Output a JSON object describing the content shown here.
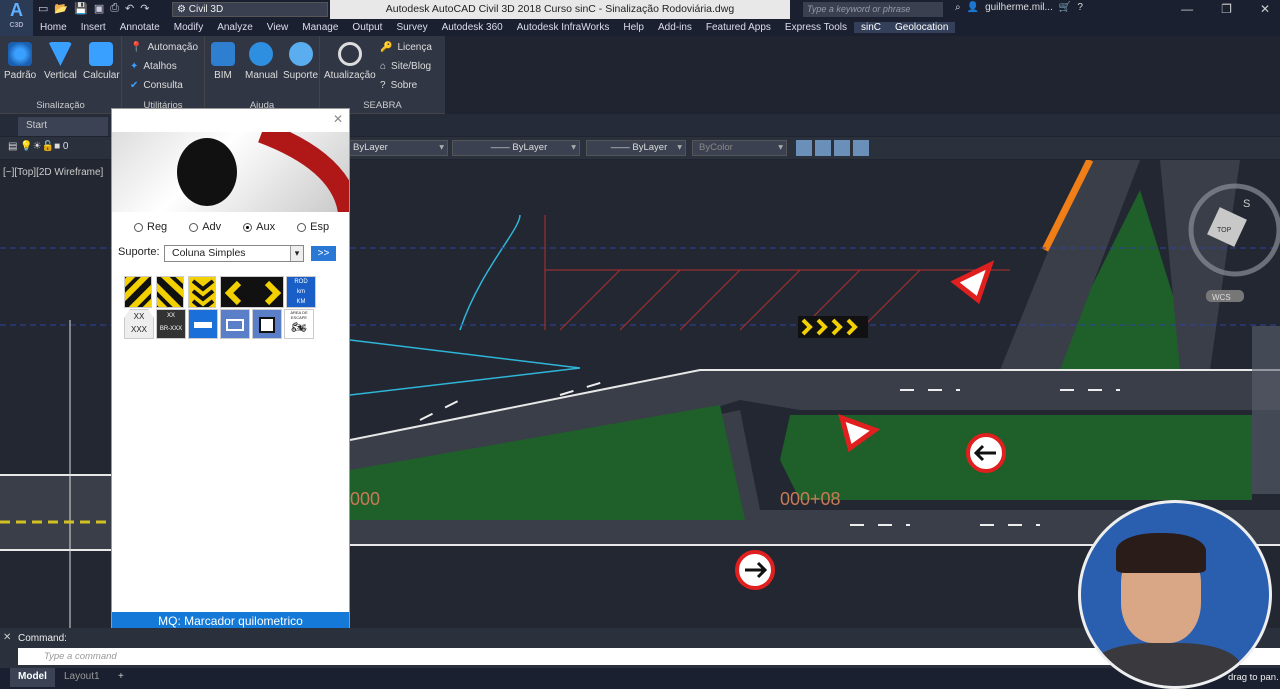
{
  "app": {
    "logo_top": "A",
    "logo_bottom": "C3D",
    "workspace": "Civil 3D",
    "title": "Autodesk AutoCAD Civil 3D 2018   Curso sinC - Sinalização Rodoviária.dwg",
    "search_placeholder": "Type a keyword or phrase",
    "user": "guilherme.mil..."
  },
  "menu": [
    "Home",
    "Insert",
    "Annotate",
    "Modify",
    "Analyze",
    "View",
    "Manage",
    "Output",
    "Survey",
    "Autodesk 360",
    "Autodesk InfraWorks",
    "Help",
    "Add-ins",
    "Featured Apps",
    "Express Tools",
    "sinC",
    "Geolocation"
  ],
  "ribbon": {
    "sinalizacao": {
      "label": "Sinalização",
      "buttons": [
        "Padrão",
        "Vertical",
        "Calcular"
      ]
    },
    "utilitarios": {
      "label": "Utilitários",
      "items": [
        "Automação",
        "Atalhos",
        "Consulta"
      ]
    },
    "ajuda": {
      "label": "Ajuda",
      "buttons": [
        "BIM",
        "Manual",
        "Suporte"
      ]
    },
    "seabra": {
      "label": "SEABRA",
      "button": "Atualização",
      "items": [
        "Licença",
        "Site/Blog",
        "Sobre"
      ]
    }
  },
  "tabs": {
    "start": "Start"
  },
  "layers": {
    "layer0": "0",
    "color": "ByLayer",
    "linetype": "ByLayer",
    "lineweight": "ByLayer",
    "plotstyle": "ByColor"
  },
  "viewport": {
    "label": "[−][Top][2D Wireframe]",
    "compass": "S",
    "cube": "TOP",
    "wcs": "WCS",
    "station_left": "000",
    "station_right": "000+08"
  },
  "palette": {
    "radios": [
      {
        "label": "Reg",
        "selected": false
      },
      {
        "label": "Adv",
        "selected": false
      },
      {
        "label": "Aux",
        "selected": true
      },
      {
        "label": "Esp",
        "selected": false
      }
    ],
    "support_label": "Suporte:",
    "support_value": "Coluna Simples",
    "go_button": ">>",
    "sign_texts": {
      "km_top": "ROD",
      "km_mid": "km",
      "km_bot": "KM",
      "shield1_top": "XX",
      "shield1_bot": "XXX",
      "shield2_top": "XX",
      "shield2_bot": "BR-XXX",
      "area_label": "ÁREA DE ESCAPE"
    },
    "footer": "MQ: Marcador quilometrico"
  },
  "command": {
    "label": "Command:",
    "placeholder": "Type a command"
  },
  "status": {
    "model": "Model",
    "layout": "Layout1",
    "hint": "drag to pan."
  }
}
